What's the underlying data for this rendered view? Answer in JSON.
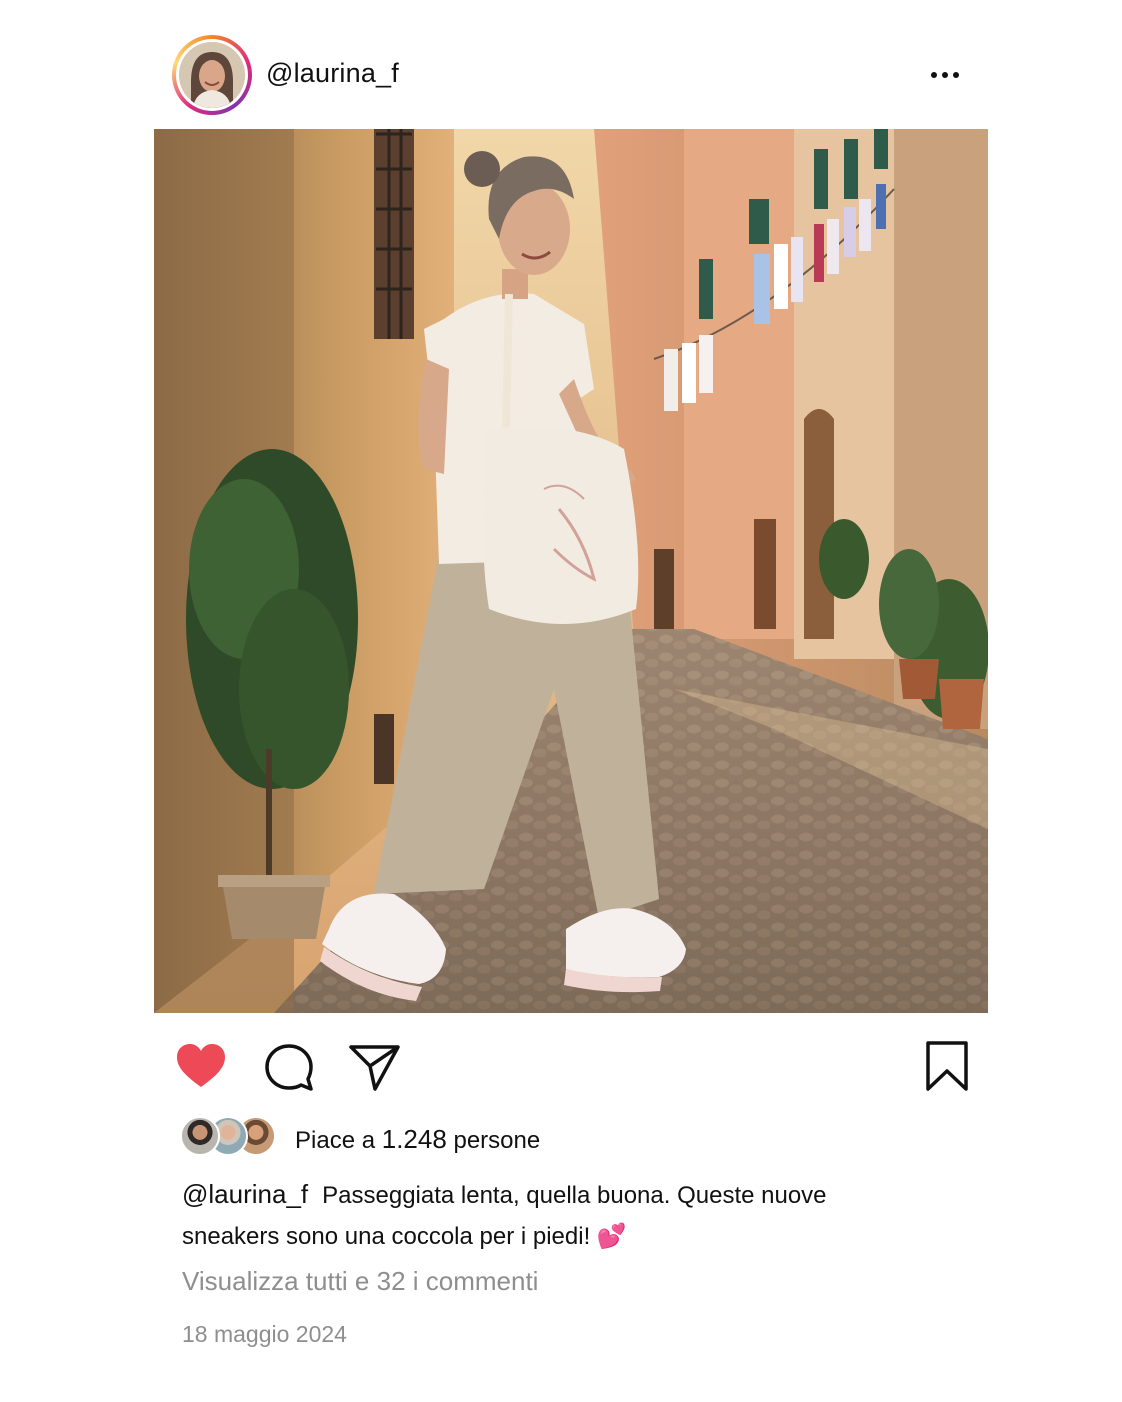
{
  "post": {
    "username": "@laurina_f",
    "more_icon": "more-horizontal-icon",
    "photo_alt": "Woman walking in a cobblestone alley wearing white sneakers",
    "actions": {
      "like_icon": "heart-filled-icon",
      "like_color": "#ed4956",
      "comment_icon": "comment-icon",
      "share_icon": "paper-plane-icon",
      "save_icon": "bookmark-icon"
    },
    "likes": {
      "prefix": "Piace a",
      "count": "1.248",
      "suffix": "persone"
    },
    "caption": {
      "username": "@laurina_f",
      "text": "Passeggiata lenta, quella buona. Queste nuove sneakers sono una coccola per i piedi!",
      "emoji": "💕"
    },
    "view_comments": "Visualizza tutti e 32 i commenti",
    "date": "18 maggio 2024"
  }
}
